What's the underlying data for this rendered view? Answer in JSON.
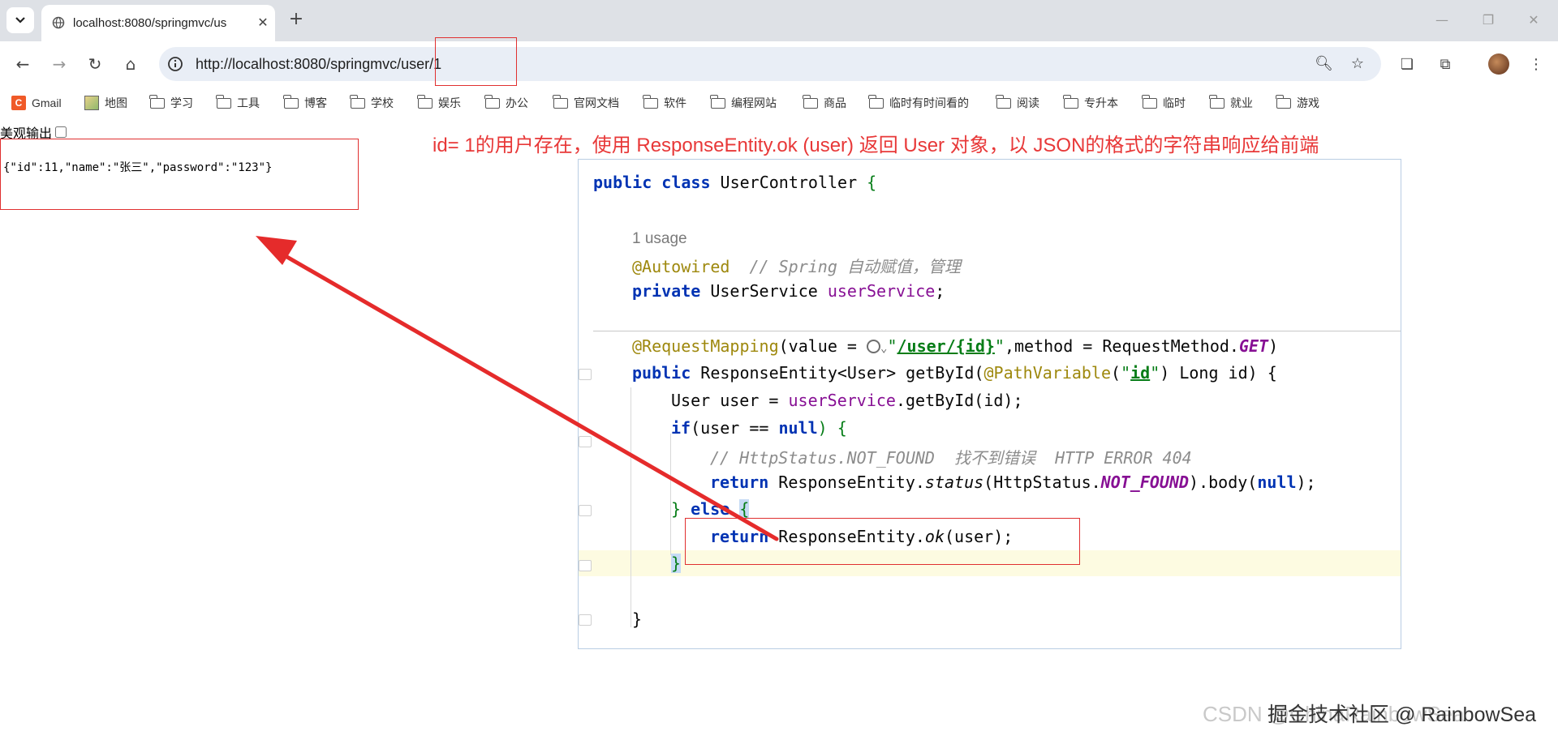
{
  "tab": {
    "title": "localhost:8080/springmvc/us"
  },
  "toolbar": {
    "url": "http://localhost:8080/springmvc/user/1"
  },
  "bookmarks": [
    {
      "label": "Gmail",
      "icon": "gmail-icon"
    },
    {
      "label": "地图",
      "icon": "map-icon"
    },
    {
      "label": "学习",
      "icon": "folder-icon"
    },
    {
      "label": "工具",
      "icon": "folder-icon"
    },
    {
      "label": "博客",
      "icon": "folder-icon"
    },
    {
      "label": "学校",
      "icon": "folder-icon"
    },
    {
      "label": "娱乐",
      "icon": "folder-icon"
    },
    {
      "label": "办公",
      "icon": "folder-icon"
    },
    {
      "label": "官网文档",
      "icon": "folder-icon"
    },
    {
      "label": "软件",
      "icon": "folder-icon"
    },
    {
      "label": "编程网站",
      "icon": "folder-icon"
    },
    {
      "label": "商品",
      "icon": "folder-icon"
    },
    {
      "label": "临时有时间看的",
      "icon": "folder-icon"
    },
    {
      "label": "阅读",
      "icon": "folder-icon"
    },
    {
      "label": "专升本",
      "icon": "folder-icon"
    },
    {
      "label": "临时",
      "icon": "folder-icon"
    },
    {
      "label": "就业",
      "icon": "folder-icon"
    },
    {
      "label": "游戏",
      "icon": "folder-icon"
    }
  ],
  "page": {
    "pretty_print_label": "美观输出",
    "json_body": "{\"id\":11,\"name\":\"张三\",\"password\":\"123\"}"
  },
  "annotation": "id= 1的用户存在，使用 ResponseEntity.ok (user) 返回  User 对象，以 JSON的格式的字符串响应给前端",
  "code": {
    "l1_kw": "public class",
    "l1_name": " UserController ",
    "l1_brace": "{",
    "usage": "1 usage",
    "autowired": "@Autowired",
    "autowired_comment": "// Spring 自动赋值，管理",
    "l3_kw": "private",
    "l3_type": " UserService ",
    "l3_field": "userService",
    "l3_end": ";",
    "rm_ann": "@RequestMapping",
    "rm_open": "(value = ",
    "rm_q1": "\"",
    "rm_path": "/user/{id}",
    "rm_q2": "\"",
    "rm_mid": ",method = RequestMethod.",
    "rm_get": "GET",
    "rm_close": ")",
    "m_kw": "public",
    "m_sig1": " ResponseEntity<User> getById(",
    "m_pv": "@PathVariable",
    "m_pv_open": "(",
    "m_pv_q1": "\"",
    "m_pv_id": "id",
    "m_pv_q2": "\"",
    "m_pv_close": ")",
    "m_sig2": " Long id) {",
    "u_type": "User user = ",
    "u_field": "userService",
    "u_call": ".getById(id);",
    "if_kw": "if",
    "if_cond": "(user == ",
    "if_null": "null",
    "if_end": ") {",
    "nf_comment": "// HttpStatus.NOT_FOUND  找不到错误  HTTP ERROR 404",
    "r1_kw": "return",
    "r1_a": " ResponseEntity.",
    "r1_status": "status",
    "r1_b": "(HttpStatus.",
    "r1_nf": "NOT_FOUND",
    "r1_c": ").body(",
    "r1_null": "null",
    "r1_d": ");",
    "else_brace": "}",
    "else_kw": " else ",
    "else_open": "{",
    "r2_kw": "return",
    "r2_a": " ResponseEntity.",
    "r2_ok": "ok",
    "r2_b": "(user);",
    "close_inner": "}",
    "close_method": "}"
  },
  "watermark": {
    "light": "CSDN @ChinaRainbowSea",
    "dark": "掘金技术社区 @ RainbowSea"
  },
  "colors": {
    "annotation_red": "#e83838",
    "tab_strip": "#dee1e6",
    "omnibox": "#e9eef6"
  }
}
